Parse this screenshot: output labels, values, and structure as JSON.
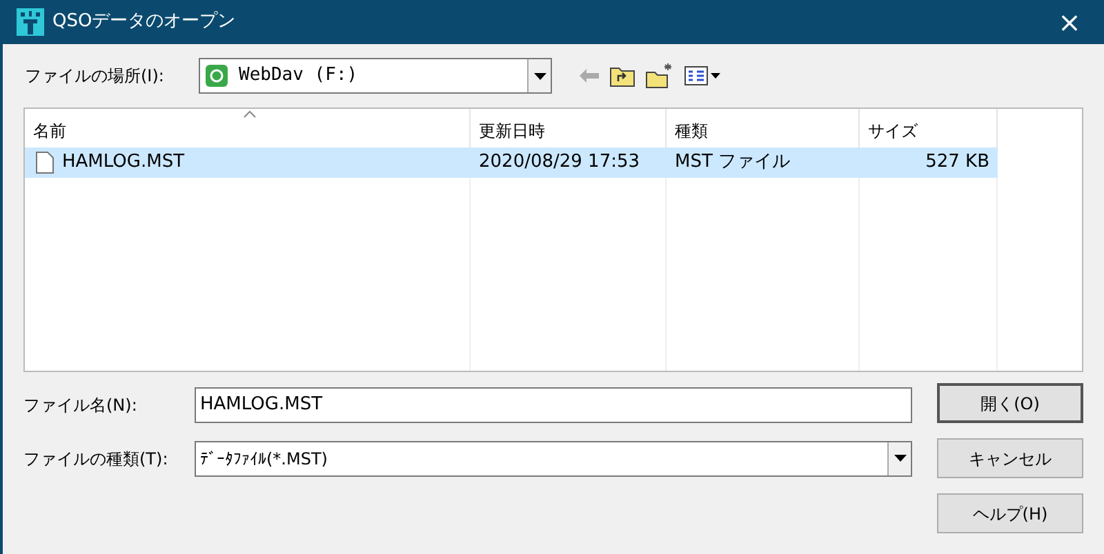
{
  "window": {
    "title": "QSOデータのオープン",
    "close": "×"
  },
  "location": {
    "label": "ファイルの場所(I):",
    "value": "WebDav (F:)"
  },
  "file_list": {
    "columns": [
      "名前",
      "更新日時",
      "種類",
      "サイズ"
    ],
    "rows": [
      {
        "name": "HAMLOG.MST",
        "modified": "2020/08/29 17:53",
        "type": "MST ファイル",
        "size": "527 KB",
        "selected": true
      }
    ]
  },
  "file_name": {
    "label": "ファイル名(N):",
    "value": "HAMLOG.MST"
  },
  "file_type": {
    "label": "ファイルの種類(T):",
    "value": "ﾃﾞｰﾀﾌｧｲﾙ(*.MST)"
  },
  "buttons": [
    "開く(O)",
    "キャンセル",
    "ヘルプ(H)"
  ]
}
